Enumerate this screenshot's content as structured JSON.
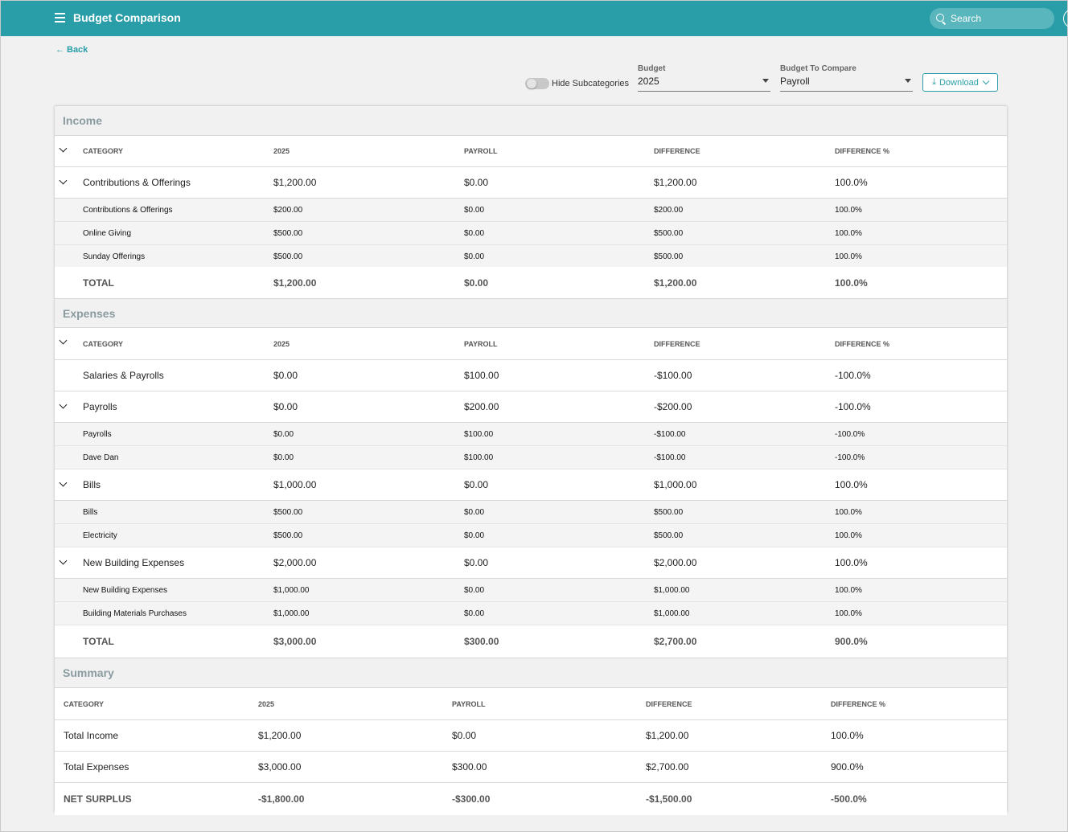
{
  "header": {
    "title": "Budget Comparison",
    "search_placeholder": "Search"
  },
  "back_label": "Back",
  "toggle_label": "Hide Subcategories",
  "budget_select": {
    "label": "Budget",
    "value": "2025"
  },
  "compare_select": {
    "label": "Budget To Compare",
    "value": "Payroll"
  },
  "download_label": "Download",
  "columns": [
    "CATEGORY",
    "2025",
    "PAYROLL",
    "DIFFERENCE",
    "DIFFERENCE %"
  ],
  "income": {
    "title": "Income",
    "groups": [
      {
        "name": "Contributions & Offerings",
        "a": "$1,200.00",
        "b": "$0.00",
        "d": "$1,200.00",
        "p": "100.0%",
        "subs": [
          {
            "name": "Contributions & Offerings",
            "a": "$200.00",
            "b": "$0.00",
            "d": "$200.00",
            "p": "100.0%"
          },
          {
            "name": "Online Giving",
            "a": "$500.00",
            "b": "$0.00",
            "d": "$500.00",
            "p": "100.0%"
          },
          {
            "name": "Sunday Offerings",
            "a": "$500.00",
            "b": "$0.00",
            "d": "$500.00",
            "p": "100.0%"
          }
        ]
      }
    ],
    "total": {
      "name": "TOTAL",
      "a": "$1,200.00",
      "b": "$0.00",
      "d": "$1,200.00",
      "p": "100.0%"
    }
  },
  "expenses": {
    "title": "Expenses",
    "groups": [
      {
        "name": "Salaries & Payrolls",
        "a": "$0.00",
        "b": "$100.00",
        "d": "-$100.00",
        "p": "-100.0%",
        "subs": []
      },
      {
        "name": "Payrolls",
        "a": "$0.00",
        "b": "$200.00",
        "d": "-$200.00",
        "p": "-100.0%",
        "subs": [
          {
            "name": "Payrolls",
            "a": "$0.00",
            "b": "$100.00",
            "d": "-$100.00",
            "p": "-100.0%"
          },
          {
            "name": "Dave Dan",
            "a": "$0.00",
            "b": "$100.00",
            "d": "-$100.00",
            "p": "-100.0%"
          }
        ]
      },
      {
        "name": "Bills",
        "a": "$1,000.00",
        "b": "$0.00",
        "d": "$1,000.00",
        "p": "100.0%",
        "subs": [
          {
            "name": "Bills",
            "a": "$500.00",
            "b": "$0.00",
            "d": "$500.00",
            "p": "100.0%"
          },
          {
            "name": "Electricity",
            "a": "$500.00",
            "b": "$0.00",
            "d": "$500.00",
            "p": "100.0%"
          }
        ]
      },
      {
        "name": "New Building Expenses",
        "a": "$2,000.00",
        "b": "$0.00",
        "d": "$2,000.00",
        "p": "100.0%",
        "subs": [
          {
            "name": "New Building Expenses",
            "a": "$1,000.00",
            "b": "$0.00",
            "d": "$1,000.00",
            "p": "100.0%"
          },
          {
            "name": "Building Materials Purchases",
            "a": "$1,000.00",
            "b": "$0.00",
            "d": "$1,000.00",
            "p": "100.0%"
          }
        ]
      }
    ],
    "total": {
      "name": "TOTAL",
      "a": "$3,000.00",
      "b": "$300.00",
      "d": "$2,700.00",
      "p": "900.0%"
    }
  },
  "summary": {
    "title": "Summary",
    "rows": [
      {
        "name": "Total Income",
        "a": "$1,200.00",
        "b": "$0.00",
        "d": "$1,200.00",
        "p": "100.0%"
      },
      {
        "name": "Total Expenses",
        "a": "$3,000.00",
        "b": "$300.00",
        "d": "$2,700.00",
        "p": "900.0%"
      }
    ],
    "net": {
      "name": "NET SURPLUS",
      "a": "-$1,800.00",
      "b": "-$300.00",
      "d": "-$1,500.00",
      "p": "-500.0%"
    }
  }
}
